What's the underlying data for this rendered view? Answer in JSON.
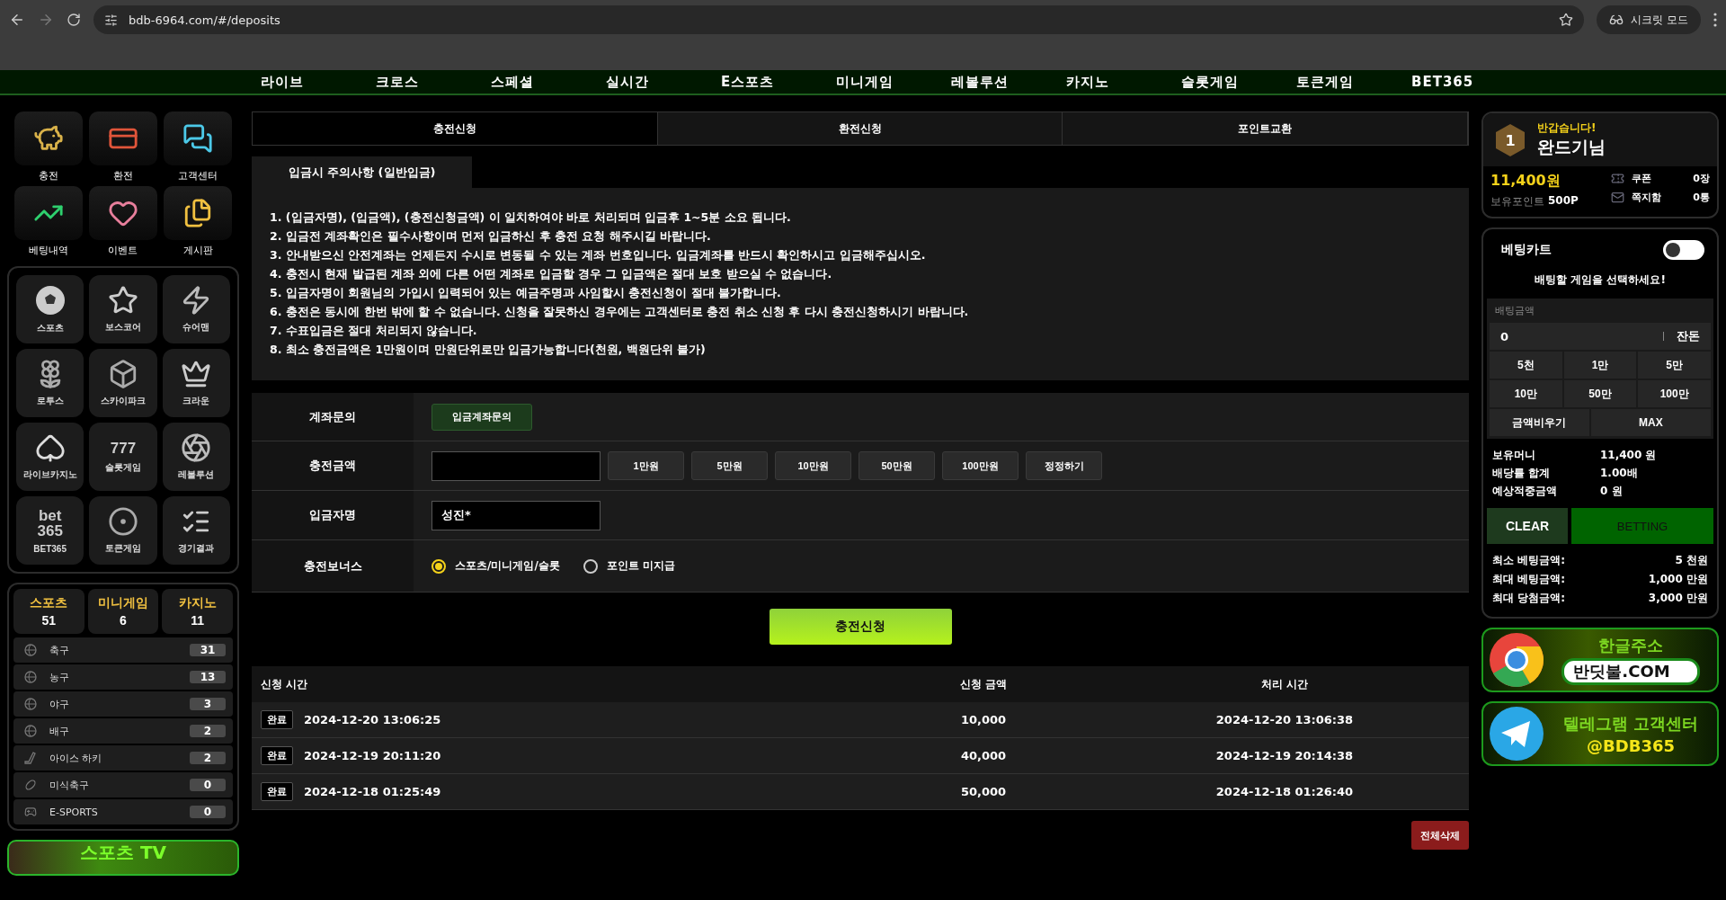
{
  "browser": {
    "url": "bdb-6964.com/#/deposits",
    "incognito_label": "시크릿 모드"
  },
  "nav": [
    "라이브",
    "크로스",
    "스페셜",
    "실시간",
    "E스포츠",
    "미니게임",
    "레볼루션",
    "카지노",
    "슬롯게임",
    "토큰게임",
    "BET365"
  ],
  "quick_menu": [
    {
      "label": "충전"
    },
    {
      "label": "환전"
    },
    {
      "label": "고객센터"
    },
    {
      "label": "베팅내역"
    },
    {
      "label": "이벤트"
    },
    {
      "label": "게시판"
    }
  ],
  "games": [
    {
      "label": "스포츠"
    },
    {
      "label": "보스코어"
    },
    {
      "label": "슈어맨"
    },
    {
      "label": "로투스"
    },
    {
      "label": "스카이파크"
    },
    {
      "label": "크라운"
    },
    {
      "label": "라이브카지노"
    },
    {
      "label": "슬롯게임",
      "logo": "777"
    },
    {
      "label": "레볼루션"
    },
    {
      "label": "BET365",
      "logo": "bet 365"
    },
    {
      "label": "토큰게임"
    },
    {
      "label": "경기결과"
    }
  ],
  "counts": [
    {
      "label": "스포츠",
      "count": "51"
    },
    {
      "label": "미니게임",
      "count": "6"
    },
    {
      "label": "카지노",
      "count": "11"
    }
  ],
  "sports": [
    {
      "name": "축구",
      "count": "31"
    },
    {
      "name": "농구",
      "count": "13"
    },
    {
      "name": "야구",
      "count": "3"
    },
    {
      "name": "배구",
      "count": "2"
    },
    {
      "name": "아이스 하키",
      "count": "2"
    },
    {
      "name": "미식축구",
      "count": "0"
    },
    {
      "name": "E-SPORTS",
      "count": "0"
    }
  ],
  "sports_tv_banner": "스포츠 TV",
  "tabs": [
    {
      "label": "충전신청",
      "selected": true
    },
    {
      "label": "환전신청",
      "selected": false
    },
    {
      "label": "포인트교환",
      "selected": false
    }
  ],
  "notice": {
    "title": "입금시 주의사항 (일반입금)",
    "lines": [
      "1. (입금자명), (입금액), (충전신청금액) 이 일치하여야 바로 처리되며 입금후 1~5분 소요 됩니다.",
      "2. 입금전 계좌확인은 필수사항이며 먼저 입금하신 후 충전 요청 해주시길 바랍니다.",
      "3. 안내받으신 안전계좌는 언제든지 수시로 변동될 수 있는 계좌 번호입니다. 입금계좌를 반드시 확인하시고 입금해주십시오.",
      "4. 충전시 현재 발급된 계좌 외에 다른 어떤 계좌로 입금할 경우 그 입금액은 절대 보호 받으실 수 없습니다.",
      "5. 입금자명이 회원님의 가입시 입력되어 있는 예금주명과 사임할시 충전신청이 절대 불가합니다.",
      "6. 충전은 동시에 한번 밖에 할 수 없습니다. 신청을 잘못하신 경우에는 고객센터로 충전 취소 신청 후 다시 충전신청하시기 바랍니다.",
      "7. 수표입금은 절대 처리되지 않습니다.",
      "8. 최소 충전금액은 1만원이며 만원단위로만 입금가능합니다(천원, 백원단위 불가)"
    ]
  },
  "form": {
    "account_label": "계좌문의",
    "account_button": "입금계좌문의",
    "amount_label": "충전금액",
    "amount_buttons": [
      "1만원",
      "5만원",
      "10만원",
      "50만원",
      "100만원",
      "정정하기"
    ],
    "depositor_label": "입금자명",
    "depositor_value": "성진*",
    "bonus_label": "충전보너스",
    "bonus_options": [
      {
        "label": "스포츠/미니게임/슬롯",
        "selected": true
      },
      {
        "label": "포인트 미지급",
        "selected": false
      }
    ]
  },
  "submit": "충전신청",
  "history": {
    "columns": [
      "신청 시간",
      "신청 금액",
      "처리 시간"
    ],
    "rows": [
      {
        "status": "완료",
        "requested": "2024-12-20 13:06:25",
        "amount": "10,000",
        "processed": "2024-12-20 13:06:38"
      },
      {
        "status": "완료",
        "requested": "2024-12-19 20:11:20",
        "amount": "40,000",
        "processed": "2024-12-19 20:14:38"
      },
      {
        "status": "완료",
        "requested": "2024-12-18 01:25:49",
        "amount": "50,000",
        "processed": "2024-12-18 01:26:40"
      }
    ],
    "delete_all": "전체삭제"
  },
  "user": {
    "level": "1",
    "greeting": "반갑습니다!",
    "name": "완드기님",
    "balance": "11,400원",
    "points_label": "보유포인트",
    "points": "500P",
    "coupon_label": "쿠폰",
    "coupon": "0장",
    "message_label": "쪽지함",
    "messages": "0통"
  },
  "bet_cart": {
    "title": "베팅카트",
    "on": false,
    "hint": "배팅할 게임을 선택하세요!",
    "amount_label": "배팅금액",
    "amount": "0",
    "change_label": "잔돈",
    "chips": [
      "5천",
      "1만",
      "5만",
      "10만",
      "50만",
      "100만"
    ],
    "clear_amount": "금액비우기",
    "max": "MAX",
    "summary": [
      {
        "label": "보유머니",
        "value": "11,400 원"
      },
      {
        "label": "배당률 합계",
        "value": "1.00배"
      },
      {
        "label": "예상적중금액",
        "value": "0 원"
      }
    ],
    "clear": "CLEAR",
    "betting": "BETTING",
    "limits": [
      {
        "label": "최소 베팅금액:",
        "value": "5 천원"
      },
      {
        "label": "최대 베팅금액:",
        "value": "1,000 만원"
      },
      {
        "label": "최대 당첨금액:",
        "value": "3,000 만원"
      }
    ]
  },
  "banners": [
    {
      "kind": "chrome",
      "title": "한글주소",
      "subtitle": "반딧불.COM"
    },
    {
      "kind": "telegram",
      "title": "텔레그램 고객센터",
      "subtitle": "@BDB365"
    }
  ]
}
